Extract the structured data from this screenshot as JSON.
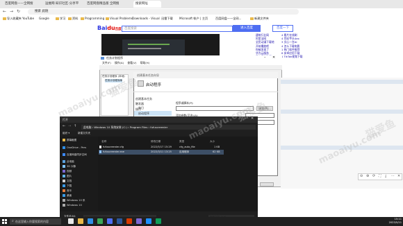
{
  "browser": {
    "tabs": [
      "百度网盘——全网搜",
      "运维网-知识社区-分享平台",
      "百度网盘精品版 全网搜",
      "搜索网址"
    ],
    "address": "搜索 此链",
    "bookmarks": [
      "导入收藏夹",
      "YouTube",
      "Google",
      "学习",
      "资料",
      "Programming",
      "Visual Problems",
      "Downloads - Visual",
      "迅雷下载",
      "Microsoft 帐户 | 主页",
      "百度网盘——全网...",
      "新建文件夹"
    ]
  },
  "baidu": {
    "logo_a": "Bai",
    "logo_b": "du",
    "logo_suffix": "百度",
    "search_placeholder": "百度搜索",
    "search_btn": "进入百度",
    "search_btn2": "百度一下",
    "results_left": [
      "建筑行业网",
      "阿里法网",
      "全民动漫下载地",
      "开始播放吧",
      "你被发现了",
      "华为云服务",
      "正在播放动漫",
      "文件..."
    ],
    "results_right": [
      "4 看片在线刷",
      "4 世纪芋头4ex",
      "3 文心一言AI",
      "4 怎么下载电影",
      "1 热门软件推荐",
      "6 安卓应用下载",
      "1 TikTok视频下载"
    ]
  },
  "task_scheduler": {
    "title": "任务计划程序",
    "menu": [
      "文件(F)",
      "操作(A)",
      "查看(V)",
      "帮助(H)"
    ],
    "tree": [
      "任务计划程序 (本地)",
      "任务计划程序库"
    ]
  },
  "create_task": {
    "title": "创建基本任务向导",
    "heading": "启动程序",
    "side_items": [
      "创建基本任务",
      "触发器",
      "每日",
      "操作",
      "启动程序",
      "完成"
    ],
    "program_label": "程序或脚本(P):",
    "browse_btn": "浏览(R)...",
    "args_label": "添加参数(可选)(A):",
    "start_label": "起始于(可选)(T):"
  },
  "file_dialog": {
    "title": "打开",
    "breadcrumb": [
      "此电脑",
      "Windows 10 系统安装 (C:)",
      "Program Files",
      "fufuscreenier"
    ],
    "search_placeholder": "搜索\"fufuscreenier\"",
    "toolbar": [
      "组织 ▾",
      "新建文件夹"
    ],
    "sidebar": [
      "屏幕截图",
      "OneDrive - Pers",
      "百度网盘同步空间",
      "此电脑",
      "3D 对象",
      "视频",
      "图片",
      "文档",
      "下载",
      "音乐",
      "桌面",
      "Windows 10 系",
      "Windows 10"
    ],
    "columns": [
      "名称",
      "修改日期",
      "类型",
      "大小"
    ],
    "files": [
      {
        "name": "fufuscreenier.cfg",
        "date": "2022/5/17 15:29",
        "type": "cfg_auto_file",
        "size": "1 KB"
      },
      {
        "name": "fufuscreenier.exe",
        "date": "2022/3/11 13:25",
        "type": "应用程序",
        "size": "62 KB"
      }
    ],
    "filename_label": "文件名(N):",
    "filename": "fufuscreenier.exe",
    "filetype": "所有文件 (*.*)",
    "open_btn": "打开(O)",
    "cancel_btn": "取消"
  },
  "taskbar": {
    "search": "在这里输入你要搜索的内容",
    "time": "15:11",
    "date": "2023/5/11"
  },
  "watermark": {
    "cn": "猫爱鱼",
    "en": "maoaiyu.com"
  },
  "colors": {
    "baidu_blue": "#4e6ef2",
    "baidu_red": "#e10602",
    "dark_bg": "#1f1f1f",
    "selection": "#3d4f66"
  }
}
